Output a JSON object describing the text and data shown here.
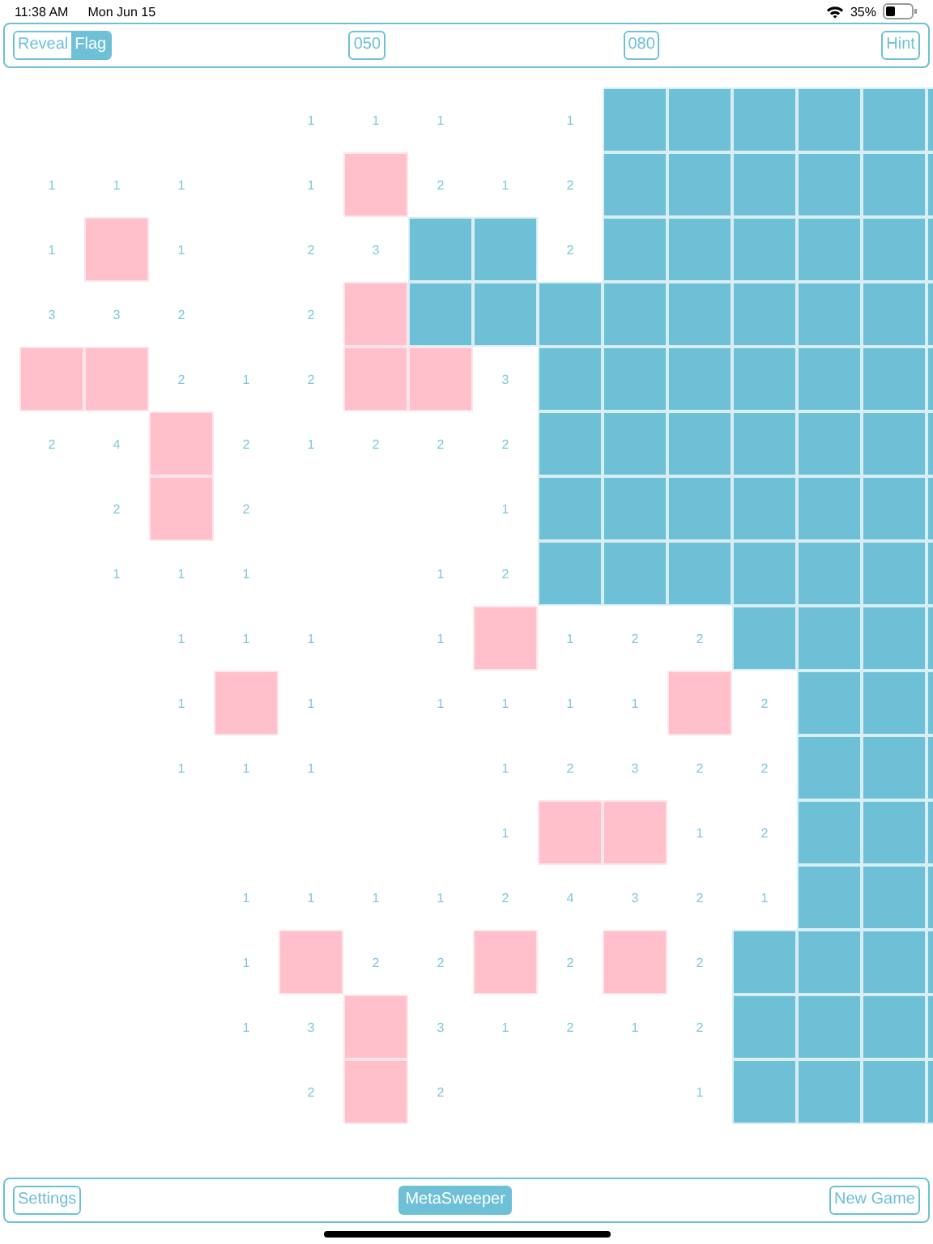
{
  "status_bar": {
    "time": "11:38 AM",
    "date": "Mon Jun 15",
    "battery": "35%"
  },
  "toolbar": {
    "modes": [
      {
        "label": "Reveal",
        "selected": false
      },
      {
        "label": "Flag",
        "selected": true
      }
    ],
    "counters": [
      "050",
      "080"
    ],
    "hint": "Hint"
  },
  "board": {
    "rows": [
      [
        {
          "kind": "empty"
        },
        {
          "kind": "empty"
        },
        {
          "kind": "empty"
        },
        {
          "kind": "empty"
        },
        {
          "kind": "number",
          "text": "1"
        },
        {
          "kind": "number",
          "text": "1"
        },
        {
          "kind": "number",
          "text": "1"
        },
        {
          "kind": "empty"
        },
        {
          "kind": "number",
          "text": "1"
        },
        {
          "kind": "hidden"
        },
        {
          "kind": "hidden"
        },
        {
          "kind": "hidden"
        },
        {
          "kind": "hidden"
        },
        {
          "kind": "hidden"
        },
        {
          "kind": "hidden"
        }
      ],
      [
        {
          "kind": "number",
          "text": "1"
        },
        {
          "kind": "number",
          "text": "1"
        },
        {
          "kind": "number",
          "text": "1"
        },
        {
          "kind": "empty"
        },
        {
          "kind": "number",
          "text": "1"
        },
        {
          "kind": "flag"
        },
        {
          "kind": "number",
          "text": "2"
        },
        {
          "kind": "number",
          "text": "1"
        },
        {
          "kind": "number",
          "text": "2"
        },
        {
          "kind": "hidden"
        },
        {
          "kind": "hidden"
        },
        {
          "kind": "hidden"
        },
        {
          "kind": "hidden"
        },
        {
          "kind": "hidden"
        },
        {
          "kind": "hidden"
        }
      ],
      [
        {
          "kind": "number",
          "text": "1"
        },
        {
          "kind": "flag"
        },
        {
          "kind": "number",
          "text": "1"
        },
        {
          "kind": "empty"
        },
        {
          "kind": "number",
          "text": "2"
        },
        {
          "kind": "number",
          "text": "3"
        },
        {
          "kind": "hidden"
        },
        {
          "kind": "hidden"
        },
        {
          "kind": "number",
          "text": "2"
        },
        {
          "kind": "hidden"
        },
        {
          "kind": "hidden"
        },
        {
          "kind": "hidden"
        },
        {
          "kind": "hidden"
        },
        {
          "kind": "hidden"
        },
        {
          "kind": "hidden"
        }
      ],
      [
        {
          "kind": "number",
          "text": "3"
        },
        {
          "kind": "number",
          "text": "3"
        },
        {
          "kind": "number",
          "text": "2"
        },
        {
          "kind": "empty"
        },
        {
          "kind": "number",
          "text": "2"
        },
        {
          "kind": "flag"
        },
        {
          "kind": "hidden"
        },
        {
          "kind": "hidden"
        },
        {
          "kind": "hidden"
        },
        {
          "kind": "hidden"
        },
        {
          "kind": "hidden"
        },
        {
          "kind": "hidden"
        },
        {
          "kind": "hidden"
        },
        {
          "kind": "hidden"
        },
        {
          "kind": "hidden"
        }
      ],
      [
        {
          "kind": "flag"
        },
        {
          "kind": "flag"
        },
        {
          "kind": "number",
          "text": "2"
        },
        {
          "kind": "number",
          "text": "1"
        },
        {
          "kind": "number",
          "text": "2"
        },
        {
          "kind": "flag"
        },
        {
          "kind": "flag"
        },
        {
          "kind": "number",
          "text": "3"
        },
        {
          "kind": "hidden"
        },
        {
          "kind": "hidden"
        },
        {
          "kind": "hidden"
        },
        {
          "kind": "hidden"
        },
        {
          "kind": "hidden"
        },
        {
          "kind": "hidden"
        },
        {
          "kind": "hidden"
        }
      ],
      [
        {
          "kind": "number",
          "text": "2"
        },
        {
          "kind": "number",
          "text": "4"
        },
        {
          "kind": "flag"
        },
        {
          "kind": "number",
          "text": "2"
        },
        {
          "kind": "number",
          "text": "1"
        },
        {
          "kind": "number",
          "text": "2"
        },
        {
          "kind": "number",
          "text": "2"
        },
        {
          "kind": "number",
          "text": "2"
        },
        {
          "kind": "hidden"
        },
        {
          "kind": "hidden"
        },
        {
          "kind": "hidden"
        },
        {
          "kind": "hidden"
        },
        {
          "kind": "hidden"
        },
        {
          "kind": "hidden"
        },
        {
          "kind": "hidden"
        }
      ],
      [
        {
          "kind": "empty"
        },
        {
          "kind": "number",
          "text": "2"
        },
        {
          "kind": "flag"
        },
        {
          "kind": "number",
          "text": "2"
        },
        {
          "kind": "empty"
        },
        {
          "kind": "empty"
        },
        {
          "kind": "empty"
        },
        {
          "kind": "number",
          "text": "1"
        },
        {
          "kind": "hidden"
        },
        {
          "kind": "hidden"
        },
        {
          "kind": "hidden"
        },
        {
          "kind": "hidden"
        },
        {
          "kind": "hidden"
        },
        {
          "kind": "hidden"
        },
        {
          "kind": "hidden"
        }
      ],
      [
        {
          "kind": "empty"
        },
        {
          "kind": "number",
          "text": "1"
        },
        {
          "kind": "number",
          "text": "1"
        },
        {
          "kind": "number",
          "text": "1"
        },
        {
          "kind": "empty"
        },
        {
          "kind": "empty"
        },
        {
          "kind": "number",
          "text": "1"
        },
        {
          "kind": "number",
          "text": "2"
        },
        {
          "kind": "hidden"
        },
        {
          "kind": "hidden"
        },
        {
          "kind": "hidden"
        },
        {
          "kind": "hidden"
        },
        {
          "kind": "hidden"
        },
        {
          "kind": "hidden"
        },
        {
          "kind": "hidden"
        }
      ],
      [
        {
          "kind": "empty"
        },
        {
          "kind": "empty"
        },
        {
          "kind": "number",
          "text": "1"
        },
        {
          "kind": "number",
          "text": "1"
        },
        {
          "kind": "number",
          "text": "1"
        },
        {
          "kind": "empty"
        },
        {
          "kind": "number",
          "text": "1"
        },
        {
          "kind": "flag"
        },
        {
          "kind": "number",
          "text": "1"
        },
        {
          "kind": "number",
          "text": "2"
        },
        {
          "kind": "number",
          "text": "2"
        },
        {
          "kind": "hidden"
        },
        {
          "kind": "hidden"
        },
        {
          "kind": "hidden"
        },
        {
          "kind": "hidden"
        }
      ],
      [
        {
          "kind": "empty"
        },
        {
          "kind": "empty"
        },
        {
          "kind": "number",
          "text": "1"
        },
        {
          "kind": "flag"
        },
        {
          "kind": "number",
          "text": "1"
        },
        {
          "kind": "empty"
        },
        {
          "kind": "number",
          "text": "1"
        },
        {
          "kind": "number",
          "text": "1"
        },
        {
          "kind": "number",
          "text": "1"
        },
        {
          "kind": "number",
          "text": "1"
        },
        {
          "kind": "flag"
        },
        {
          "kind": "number",
          "text": "2"
        },
        {
          "kind": "hidden"
        },
        {
          "kind": "hidden"
        },
        {
          "kind": "hidden"
        }
      ],
      [
        {
          "kind": "empty"
        },
        {
          "kind": "empty"
        },
        {
          "kind": "number",
          "text": "1"
        },
        {
          "kind": "number",
          "text": "1"
        },
        {
          "kind": "number",
          "text": "1"
        },
        {
          "kind": "empty"
        },
        {
          "kind": "empty"
        },
        {
          "kind": "number",
          "text": "1"
        },
        {
          "kind": "number",
          "text": "2"
        },
        {
          "kind": "number",
          "text": "3"
        },
        {
          "kind": "number",
          "text": "2"
        },
        {
          "kind": "number",
          "text": "2"
        },
        {
          "kind": "hidden"
        },
        {
          "kind": "hidden"
        },
        {
          "kind": "hidden"
        }
      ],
      [
        {
          "kind": "empty"
        },
        {
          "kind": "empty"
        },
        {
          "kind": "empty"
        },
        {
          "kind": "empty"
        },
        {
          "kind": "empty"
        },
        {
          "kind": "empty"
        },
        {
          "kind": "empty"
        },
        {
          "kind": "number",
          "text": "1"
        },
        {
          "kind": "flag"
        },
        {
          "kind": "flag"
        },
        {
          "kind": "number",
          "text": "1"
        },
        {
          "kind": "number",
          "text": "2"
        },
        {
          "kind": "hidden"
        },
        {
          "kind": "hidden"
        },
        {
          "kind": "hidden"
        }
      ],
      [
        {
          "kind": "empty"
        },
        {
          "kind": "empty"
        },
        {
          "kind": "empty"
        },
        {
          "kind": "number",
          "text": "1"
        },
        {
          "kind": "number",
          "text": "1"
        },
        {
          "kind": "number",
          "text": "1"
        },
        {
          "kind": "number",
          "text": "1"
        },
        {
          "kind": "number",
          "text": "2"
        },
        {
          "kind": "number",
          "text": "4"
        },
        {
          "kind": "number",
          "text": "3"
        },
        {
          "kind": "number",
          "text": "2"
        },
        {
          "kind": "number",
          "text": "1"
        },
        {
          "kind": "hidden"
        },
        {
          "kind": "hidden"
        },
        {
          "kind": "hidden"
        }
      ],
      [
        {
          "kind": "empty"
        },
        {
          "kind": "empty"
        },
        {
          "kind": "empty"
        },
        {
          "kind": "number",
          "text": "1"
        },
        {
          "kind": "flag"
        },
        {
          "kind": "number",
          "text": "2"
        },
        {
          "kind": "number",
          "text": "2"
        },
        {
          "kind": "flag"
        },
        {
          "kind": "number",
          "text": "2"
        },
        {
          "kind": "flag"
        },
        {
          "kind": "number",
          "text": "2"
        },
        {
          "kind": "hidden"
        },
        {
          "kind": "hidden"
        },
        {
          "kind": "hidden"
        },
        {
          "kind": "hidden"
        }
      ],
      [
        {
          "kind": "empty"
        },
        {
          "kind": "empty"
        },
        {
          "kind": "empty"
        },
        {
          "kind": "number",
          "text": "1"
        },
        {
          "kind": "number",
          "text": "3"
        },
        {
          "kind": "flag"
        },
        {
          "kind": "number",
          "text": "3"
        },
        {
          "kind": "number",
          "text": "1"
        },
        {
          "kind": "number",
          "text": "2"
        },
        {
          "kind": "number",
          "text": "1"
        },
        {
          "kind": "number",
          "text": "2"
        },
        {
          "kind": "hidden"
        },
        {
          "kind": "hidden"
        },
        {
          "kind": "hidden"
        },
        {
          "kind": "hidden"
        }
      ],
      [
        {
          "kind": "empty"
        },
        {
          "kind": "empty"
        },
        {
          "kind": "empty"
        },
        {
          "kind": "empty"
        },
        {
          "kind": "number",
          "text": "2"
        },
        {
          "kind": "flag"
        },
        {
          "kind": "number",
          "text": "2"
        },
        {
          "kind": "empty"
        },
        {
          "kind": "empty"
        },
        {
          "kind": "empty"
        },
        {
          "kind": "number",
          "text": "1"
        },
        {
          "kind": "hidden"
        },
        {
          "kind": "hidden"
        },
        {
          "kind": "hidden"
        },
        {
          "kind": "hidden"
        }
      ]
    ]
  },
  "bottom_bar": {
    "settings": "Settings",
    "title": "MetaSweeper",
    "new_game": "New Game"
  }
}
